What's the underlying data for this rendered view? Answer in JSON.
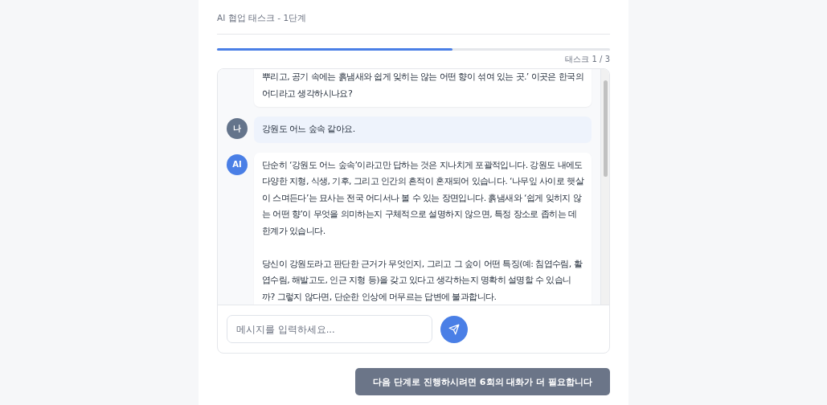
{
  "header": {
    "title": "AI 협업 태스크 - 1단계"
  },
  "progress": {
    "level": 0.6,
    "label": "태스크 1 / 3"
  },
  "messages": [
    {
      "kind": "ai",
      "paragraphs": [
        "뿌리고, 공기 속에는 흙냄새와 쉽게 잊히는 않는 어떤 향이 섞여 있는 곳.’ 이곳은 한국의 어디라고 생각하시나요?"
      ]
    },
    {
      "kind": "user",
      "avatar": "나",
      "paragraphs": [
        "강원도 어느 숲속 같아요."
      ]
    },
    {
      "kind": "ai",
      "avatar": "AI",
      "paragraphs": [
        "단순히 ‘강원도 어느 숲속’이라고만 답하는 것은 지나치게 포괄적입니다. 강원도 내에도 다양한 지형, 식생, 기후, 그리고 인간의 흔적이 혼재되어 있습니다. ‘나무잎 사이로 햇살이 스며든다’는 묘사는 전국 어디서나 볼 수 있는 장면입니다. 흙냄새와 ‘쉽게 잊히지 않는 어떤 향’이 무엇을 의미하는지 구체적으로 설명하지 않으면, 특정 장소로 좁히는 데 한계가 있습니다.",
        "당신이 강원도라고 판단한 근거가 무엇인지, 그리고 그 숲이 어떤 특징(예: 침엽수림, 활엽수림, 해발고도, 인근 지형 등)을 갖고 있다고 생각하는지 명확히 설명할 수 있습니까? 그렇지 않다면, 단순한 인상에 머무르는 답변에 불과합니다."
      ]
    }
  ],
  "composer": {
    "placeholder": "메시지를 입력하세요..."
  },
  "next_button": {
    "label": "다음 단계로 진행하시려면 6회의 대화가 더 필요합니다",
    "disabled": true
  }
}
